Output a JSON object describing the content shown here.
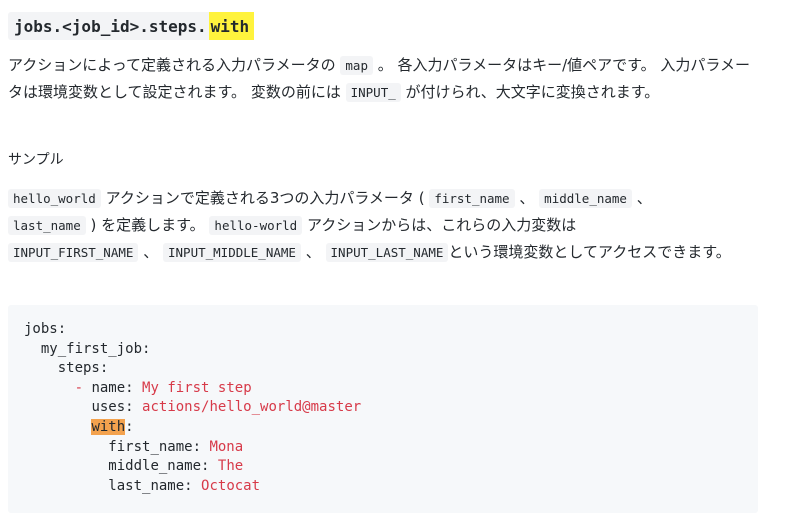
{
  "heading": {
    "path": "jobs.<job_id>.steps.",
    "highlight": "with"
  },
  "para1": {
    "t1": "アクションによって定義される入力パラメータの",
    "c1": "map",
    "t2": "。 各入力パラメータはキー/値ペアです。 入力パラメータは環境変数として設定されます。 変数の前には",
    "c2": "INPUT_",
    "t3": "が付けられ、大文字に変換されます。"
  },
  "sample_label": "サンプル",
  "para2": {
    "c1": "hello_world",
    "t1": "アクションで定義される3つの入力パラメータ (",
    "c2": "first_name",
    "t2": "、",
    "c3": "middle_name",
    "t3": "、",
    "c4": "last_name",
    "t4": ") を定義します。",
    "c5": "hello-world",
    "t5": "アクションからは、これらの入力変数は",
    "c6": "INPUT_FIRST_NAME",
    "t6": "、",
    "c7": "INPUT_MIDDLE_NAME",
    "t7": "、",
    "c8": "INPUT_LAST_NAME",
    "t8": "という環境変数としてアクセスできます。"
  },
  "code": {
    "jobs": "jobs:",
    "job": "my_first_job:",
    "steps": "steps:",
    "dash": "-",
    "name_key": "name:",
    "name_val": "My first step",
    "uses_key": "uses:",
    "uses_val": "actions/hello_world@master",
    "with_key": "with",
    "colon": ":",
    "first_key": "first_name:",
    "first_val": "Mona",
    "middle_key": "middle_name:",
    "middle_val": "The",
    "last_key": "last_name:",
    "last_val": "Octocat"
  }
}
